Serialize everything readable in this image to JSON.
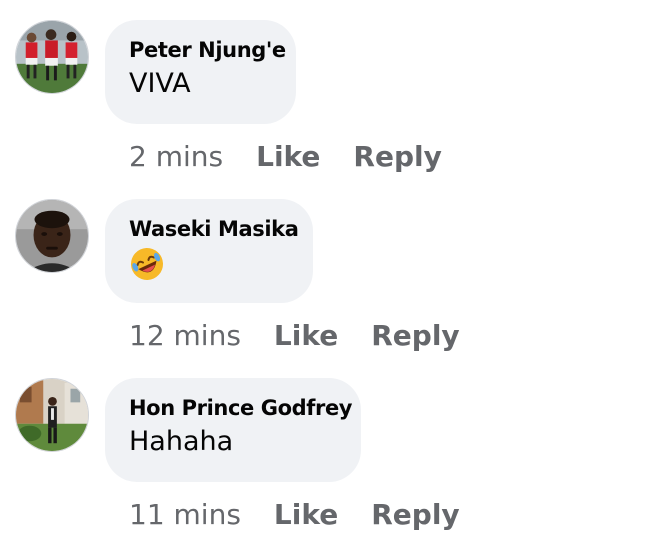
{
  "comments": [
    {
      "author": "Peter Njung'e",
      "text": "VIVA",
      "time": "2 mins",
      "like_label": "Like",
      "reply_label": "Reply",
      "avatar_icon": "football-team-photo"
    },
    {
      "author": "Waseki Masika",
      "emoji_icon": "rolling-on-floor-laughing-emoji",
      "time": "12 mins",
      "like_label": "Like",
      "reply_label": "Reply",
      "avatar_icon": "man-portrait-photo"
    },
    {
      "author": "Hon Prince Godfrey",
      "text": "Hahaha",
      "time": "11 mins",
      "like_label": "Like",
      "reply_label": "Reply",
      "avatar_icon": "man-standing-outdoors-photo"
    }
  ],
  "colors": {
    "bubble_bg": "#f0f2f5",
    "author_text": "#050505",
    "meta_text": "#65676b"
  }
}
